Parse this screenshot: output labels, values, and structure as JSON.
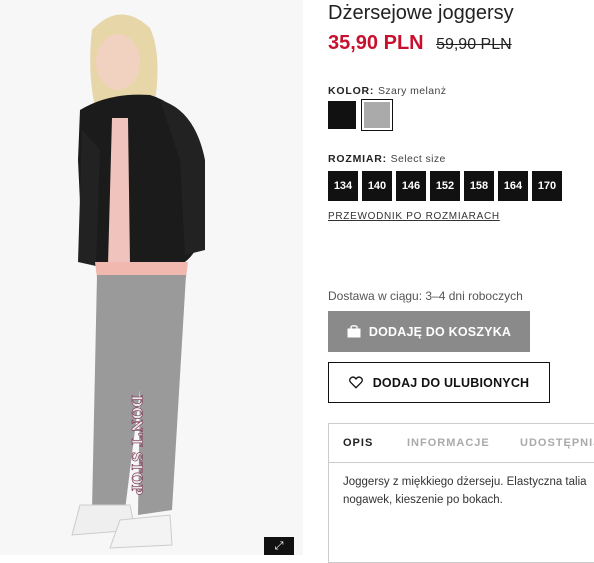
{
  "product": {
    "title": "Dżersejowe joggersy",
    "price_current": "35,90 PLN",
    "price_old": "59,90 PLN",
    "zoom_icon": "expand-icon"
  },
  "color": {
    "label": "KOLOR:",
    "selected": "Szary melanż",
    "swatches": [
      {
        "name": "black",
        "hex": "#111111"
      },
      {
        "name": "grey-melange",
        "hex": "#aaaaaa"
      }
    ]
  },
  "size": {
    "label": "ROZMIAR:",
    "selected": "Select size",
    "options": [
      "134",
      "140",
      "146",
      "152",
      "158",
      "164",
      "170"
    ],
    "guide_link": "PRZEWODNIK PO ROZMIARACH"
  },
  "delivery": "Dostawa w ciągu: 3–4 dni roboczych",
  "buttons": {
    "add_to_cart": "DODAJĘ DO KOSZYKA",
    "add_to_favorites": "DODAJ DO ULUBIONYCH"
  },
  "tabs": {
    "items": [
      "OPIS",
      "INFORMACJE",
      "UDOSTĘPNIJ"
    ],
    "active": "OPIS",
    "description": "Joggersy z miękkiego dżerseju. Elastyczna talia nogawek, kieszenie po bokach."
  },
  "image": {
    "pants_print": "DON'T STOP"
  },
  "colors": {
    "price": "#c8102e",
    "cart_button": "#8a8a8a"
  }
}
